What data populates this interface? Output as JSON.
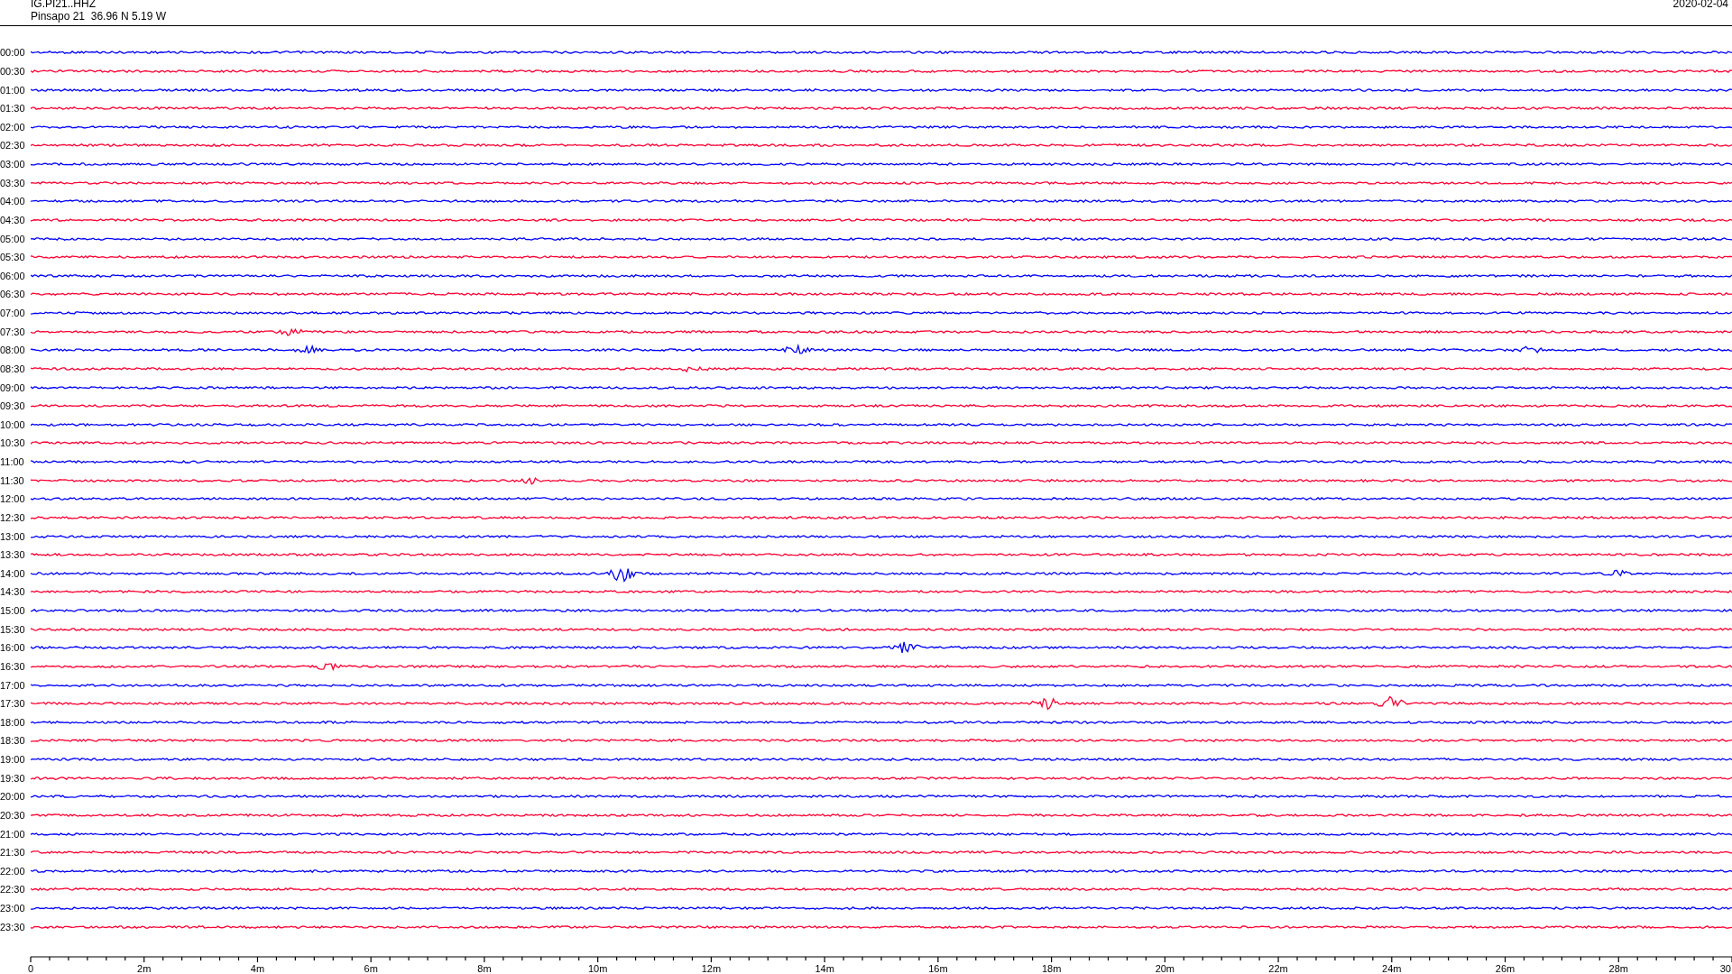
{
  "header": {
    "station": "IG.PI21..HHZ",
    "location": "Pinsapo 21  36.96 N 5.19 W",
    "date": "2020-02-04"
  },
  "rows": [
    {
      "time": "00:00",
      "color": "#0000ff"
    },
    {
      "time": "00:30",
      "color": "#ff0033"
    },
    {
      "time": "01:00",
      "color": "#0000ff"
    },
    {
      "time": "01:30",
      "color": "#ff0033"
    },
    {
      "time": "02:00",
      "color": "#0000ff"
    },
    {
      "time": "02:30",
      "color": "#ff0033"
    },
    {
      "time": "03:00",
      "color": "#0000ff"
    },
    {
      "time": "03:30",
      "color": "#ff0033"
    },
    {
      "time": "04:00",
      "color": "#0000ff"
    },
    {
      "time": "04:30",
      "color": "#ff0033"
    },
    {
      "time": "05:00",
      "color": "#0000ff"
    },
    {
      "time": "05:30",
      "color": "#ff0033"
    },
    {
      "time": "06:00",
      "color": "#0000ff"
    },
    {
      "time": "06:30",
      "color": "#ff0033"
    },
    {
      "time": "07:00",
      "color": "#0000ff"
    },
    {
      "time": "07:30",
      "color": "#ff0033"
    },
    {
      "time": "08:00",
      "color": "#0000ff"
    },
    {
      "time": "08:30",
      "color": "#ff0033"
    },
    {
      "time": "09:00",
      "color": "#0000ff"
    },
    {
      "time": "09:30",
      "color": "#ff0033"
    },
    {
      "time": "10:00",
      "color": "#0000ff"
    },
    {
      "time": "10:30",
      "color": "#ff0033"
    },
    {
      "time": "11:00",
      "color": "#0000ff"
    },
    {
      "time": "11:30",
      "color": "#ff0033"
    },
    {
      "time": "12:00",
      "color": "#0000ff"
    },
    {
      "time": "12:30",
      "color": "#ff0033"
    },
    {
      "time": "13:00",
      "color": "#0000ff"
    },
    {
      "time": "13:30",
      "color": "#ff0033"
    },
    {
      "time": "14:00",
      "color": "#0000ff"
    },
    {
      "time": "14:30",
      "color": "#ff0033"
    },
    {
      "time": "15:00",
      "color": "#0000ff"
    },
    {
      "time": "15:30",
      "color": "#ff0033"
    },
    {
      "time": "16:00",
      "color": "#0000ff"
    },
    {
      "time": "16:30",
      "color": "#ff0033"
    },
    {
      "time": "17:00",
      "color": "#0000ff"
    },
    {
      "time": "17:30",
      "color": "#ff0033"
    },
    {
      "time": "18:00",
      "color": "#0000ff"
    },
    {
      "time": "18:30",
      "color": "#ff0033"
    },
    {
      "time": "19:00",
      "color": "#0000ff"
    },
    {
      "time": "19:30",
      "color": "#ff0033"
    },
    {
      "time": "20:00",
      "color": "#0000ff"
    },
    {
      "time": "20:30",
      "color": "#ff0033"
    },
    {
      "time": "21:00",
      "color": "#0000ff"
    },
    {
      "time": "21:30",
      "color": "#ff0033"
    },
    {
      "time": "22:00",
      "color": "#0000ff"
    },
    {
      "time": "22:30",
      "color": "#ff0033"
    },
    {
      "time": "23:00",
      "color": "#0000ff"
    },
    {
      "time": "23:30",
      "color": "#ff0033"
    }
  ],
  "axis": {
    "labels": [
      "0",
      "2m",
      "4m",
      "6m",
      "8m",
      "10m",
      "12m",
      "14m",
      "16m",
      "18m",
      "20m",
      "22m",
      "24m",
      "26m",
      "28m",
      "30"
    ]
  }
}
